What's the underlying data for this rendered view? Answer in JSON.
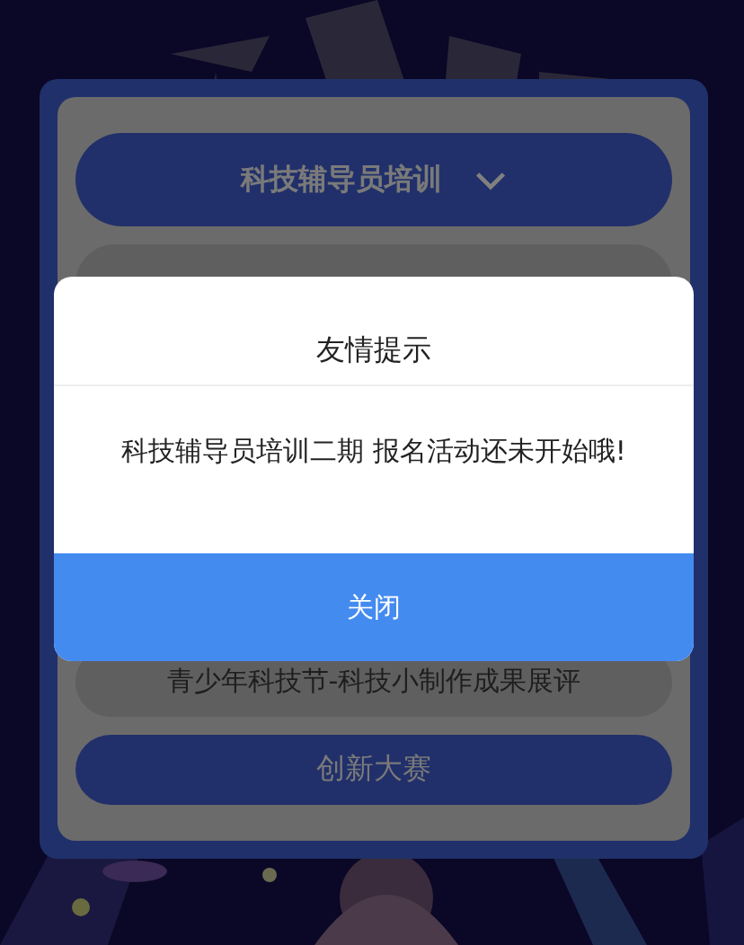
{
  "dropdown": {
    "label": "科技辅导员培训"
  },
  "items": [
    {
      "kind": "plain",
      "label": "青少年科技节-科技小制作成果展评"
    },
    {
      "kind": "button",
      "label": "创新大赛"
    }
  ],
  "dialog": {
    "title": "友情提示",
    "message": "科技辅导员培训二期 报名活动还未开始哦!",
    "button": "关闭"
  }
}
